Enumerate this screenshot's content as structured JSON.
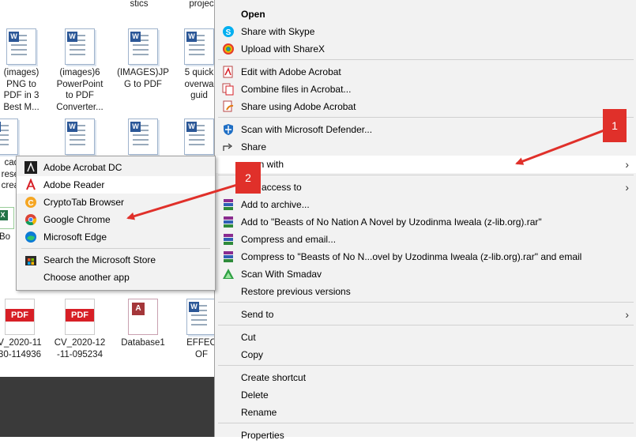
{
  "desktop": {
    "top_labels": [
      "stics",
      "projec"
    ],
    "files": [
      {
        "label": "(images)\nPNG to\nPDF in 3\nBest M...",
        "icon": "word-doc-icon"
      },
      {
        "label": "(images)6\nPowerPoint\nto PDF\nConverter...",
        "icon": "word-doc-icon"
      },
      {
        "label": "(IMAGES)JP\nG to PDF",
        "icon": "word-doc-icon"
      },
      {
        "label": "5 quick\noverwa\nguid",
        "icon": "word-doc-icon"
      },
      {
        "label": "cad\nrese\ncrea",
        "icon": "word-doc-icon"
      },
      {
        "label": "Bo",
        "icon": "excel-icon"
      },
      {
        "label": "V_2020-11\n30-114936",
        "icon": "pdf-icon"
      },
      {
        "label": "CV_2020-12\n-11-095234",
        "icon": "pdf-icon"
      },
      {
        "label": "Database1",
        "icon": "access-db-icon"
      },
      {
        "label": "EFFEC\nOF",
        "icon": "word-doc-icon"
      }
    ],
    "pdf_text": "PDF"
  },
  "context_menu": {
    "items": [
      {
        "label": "Open",
        "icon": "",
        "bold": true
      },
      {
        "label": "Share with Skype",
        "icon": "skype-icon"
      },
      {
        "label": "Upload with ShareX",
        "icon": "sharex-icon"
      },
      {
        "label": "Edit with Adobe Acrobat",
        "icon": "acrobat-icon"
      },
      {
        "label": "Combine files in Acrobat...",
        "icon": "acrobat-combine-icon"
      },
      {
        "label": "Share using Adobe Acrobat",
        "icon": "acrobat-share-icon"
      },
      {
        "label": "Scan with Microsoft Defender...",
        "icon": "defender-icon"
      },
      {
        "label": "Share",
        "icon": "share-icon"
      },
      {
        "label": "Open with",
        "icon": "",
        "submenu": true,
        "partially_obscured_text": "en with"
      },
      {
        "label": "Give access to",
        "icon": "",
        "submenu": true,
        "partially_obscured_text": "access to"
      },
      {
        "label": "Add to archive...",
        "icon": "winrar-icon"
      },
      {
        "label": "Add to \"Beasts of No Nation A Novel by Uzodinma Iweala (z-lib.org).rar\"",
        "icon": "winrar-icon"
      },
      {
        "label": "Compress and email...",
        "icon": "winrar-icon"
      },
      {
        "label": "Compress to \"Beasts of No N...ovel by Uzodinma Iweala (z-lib.org).rar\" and email",
        "icon": "winrar-icon"
      },
      {
        "label": "Scan With Smadav",
        "icon": "smadav-icon"
      },
      {
        "label": "Restore previous versions",
        "icon": ""
      },
      {
        "label": "Send to",
        "icon": "",
        "submenu": true
      },
      {
        "label": "Cut",
        "icon": ""
      },
      {
        "label": "Copy",
        "icon": ""
      },
      {
        "label": "Create shortcut",
        "icon": ""
      },
      {
        "label": "Delete",
        "icon": ""
      },
      {
        "label": "Rename",
        "icon": ""
      },
      {
        "label": "Properties",
        "icon": ""
      }
    ],
    "chevron": "›"
  },
  "open_with_submenu": {
    "items": [
      {
        "label": "Adobe Acrobat DC",
        "icon": "acrobat-dc-icon"
      },
      {
        "label": "Adobe Reader",
        "icon": "adobe-reader-icon"
      },
      {
        "label": "CryptoTab Browser",
        "icon": "cryptotab-icon"
      },
      {
        "label": "Google Chrome",
        "icon": "chrome-icon"
      },
      {
        "label": "Microsoft Edge",
        "icon": "edge-icon"
      },
      {
        "label": "Search the Microsoft Store",
        "icon": "store-icon"
      },
      {
        "label": "Choose another app",
        "icon": ""
      }
    ]
  },
  "annotations": {
    "badge1": "1",
    "badge2": "2",
    "accent": "#e0302a"
  }
}
